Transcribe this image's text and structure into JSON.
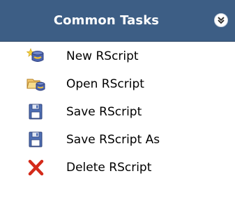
{
  "panel": {
    "title": "Common Tasks",
    "collapse_icon": "double-chevron-down-icon",
    "header_color": "#3d5e85"
  },
  "tasks": [
    {
      "label": "New RScript",
      "icon": "new-script-icon"
    },
    {
      "label": "Open RScript",
      "icon": "open-folder-icon"
    },
    {
      "label": "Save RScript",
      "icon": "floppy-disk-icon"
    },
    {
      "label": "Save RScript As",
      "icon": "floppy-disk-icon"
    },
    {
      "label": "Delete RScript",
      "icon": "red-x-delete-icon"
    }
  ]
}
